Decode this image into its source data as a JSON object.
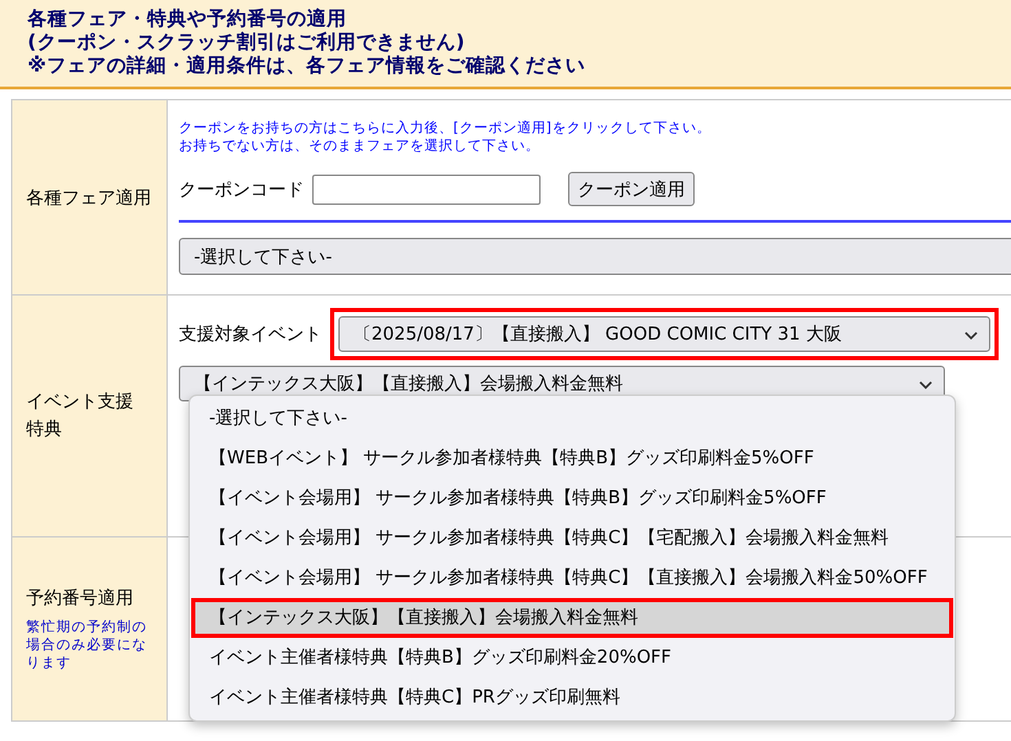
{
  "header": {
    "lines": [
      "各種フェア・特典や予約番号の適用",
      "(クーポン・スクラッチ割引はご利用できません)",
      "※フェアの詳細・適用条件は、各フェア情報をご確認ください"
    ]
  },
  "fair": {
    "label": "各種フェア適用",
    "notes": [
      "クーポンをお持ちの方はこちらに入力後、[クーポン適用]をクリックして下さい。",
      "お持ちでない方は、そのままフェアを選択して下さい。"
    ],
    "coupon_label": "クーポンコード",
    "coupon_button": "クーポン適用",
    "select": "-選択して下さい-"
  },
  "support": {
    "label": "イベント支援特典",
    "event_label": "支援対象イベント",
    "event_select": {
      "value": "〔2025/08/17〕【直接搬入】 GOOD COMIC CITY 31 大阪",
      "highlighted": true
    },
    "benefit_select": "【インテックス大阪】【直接搬入】会場搬入料金無料",
    "options": [
      {
        "label": "-選択して下さい-",
        "selected": false,
        "highlighted": false
      },
      {
        "label": "【WEBイベント】 サークル参加者様特典【特典B】グッズ印刷料金5%OFF",
        "selected": false,
        "highlighted": false
      },
      {
        "label": "【イベント会場用】 サークル参加者様特典【特典B】グッズ印刷料金5%OFF",
        "selected": false,
        "highlighted": false
      },
      {
        "label": "【イベント会場用】 サークル参加者様特典【特典C】【宅配搬入】会場搬入料金無料",
        "selected": false,
        "highlighted": false
      },
      {
        "label": "【イベント会場用】 サークル参加者様特典【特典C】【直接搬入】会場搬入料金50%OFF",
        "selected": false,
        "highlighted": false
      },
      {
        "label": "【インテックス大阪】【直接搬入】会場搬入料金無料",
        "selected": true,
        "highlighted": true
      },
      {
        "label": "イベント主催者様特典【特典B】グッズ印刷料金20%OFF",
        "selected": false,
        "highlighted": false
      },
      {
        "label": "イベント主催者様特典【特典C】PRグッズ印刷無料",
        "selected": false,
        "highlighted": false
      }
    ]
  },
  "reservation": {
    "label": "予約番号適用",
    "note": "繁忙期の予約制の場合のみ必要になります"
  }
}
